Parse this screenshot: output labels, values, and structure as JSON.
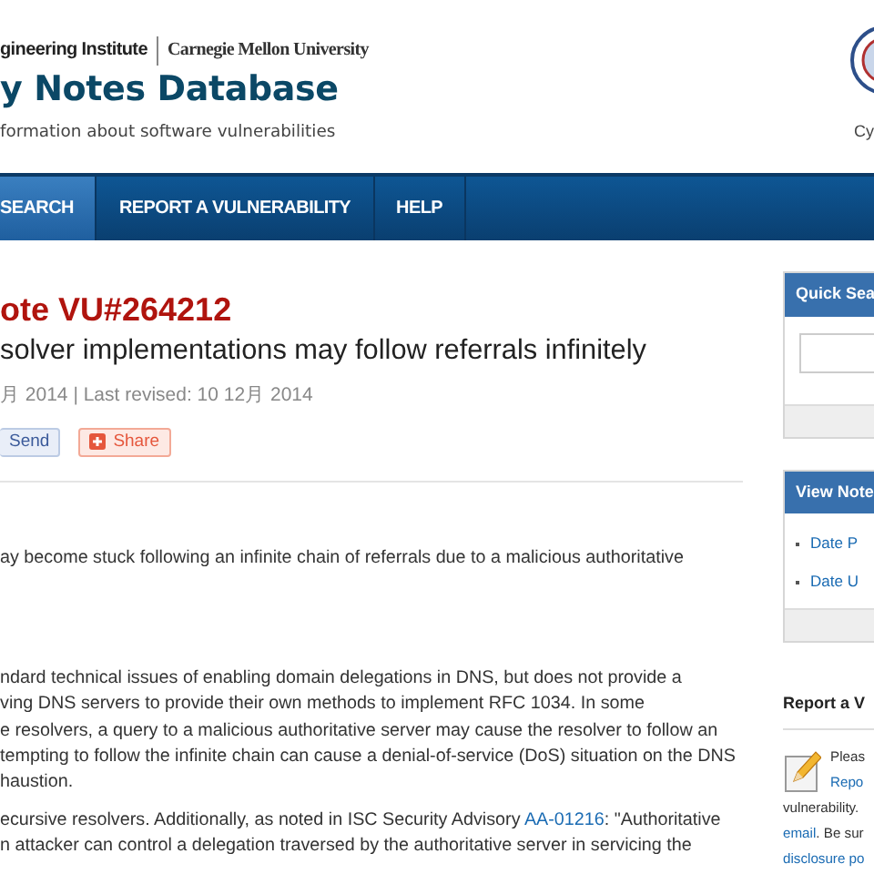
{
  "header": {
    "org_line_1": "gineering Institute",
    "org_line_2": "Carnegie Mellon University",
    "site_title": "y Notes Database",
    "tagline": "formation about software vulnerabilities",
    "partner_caption": "Cy"
  },
  "nav": [
    {
      "label": "SEARCH",
      "selected": true
    },
    {
      "label": "REPORT A VULNERABILITY",
      "selected": false
    },
    {
      "label": "HELP",
      "selected": false
    }
  ],
  "note": {
    "id_title": "ote VU#264212",
    "headline": "solver implementations may follow referrals infinitely",
    "dates": "月 2014 | Last revised: 10 12月 2014",
    "share_buttons": [
      {
        "kind": "send",
        "label": "Send"
      },
      {
        "kind": "share",
        "label": "Share"
      }
    ],
    "paragraphs": [
      {
        "lines": [
          [
            {
              "text": "ay become stuck following an infinite chain of referrals due to a malicious authoritative",
              "link": false
            }
          ]
        ]
      },
      {
        "lines": [
          [
            {
              "text": "ndard technical issues of enabling domain delegations in DNS, but does not provide a",
              "link": false
            }
          ],
          [
            {
              "text": "ving DNS servers to provide their own methods to implement RFC 1034. In some",
              "link": false
            }
          ],
          [
            {
              "text": "e resolvers, a query to a malicious authoritative server may cause the resolver to follow an",
              "link": false
            }
          ],
          [
            {
              "text": "tempting to follow the infinite chain can cause a denial-of-service (DoS) situation on the DNS",
              "link": false
            }
          ],
          [
            {
              "text": "haustion.",
              "link": false
            }
          ]
        ]
      },
      {
        "lines": [
          [
            {
              "text": "ecursive resolvers. Additionally, as noted in ISC Security Advisory ",
              "link": false
            },
            {
              "text": "AA-01216",
              "link": true
            },
            {
              "text": ": \"Authoritative",
              "link": false
            }
          ],
          [
            {
              "text": "n attacker can control a delegation traversed by the authoritative server in servicing the",
              "link": false
            }
          ]
        ]
      }
    ]
  },
  "sidebar": {
    "quick_search": {
      "title": "Quick Sea"
    },
    "view_notes": {
      "title": "View Note",
      "links": [
        "Date P",
        "Date U"
      ]
    },
    "report": {
      "title": "Report a V",
      "lines_beside_icon": [
        [
          {
            "text": "Pleas",
            "link": false
          }
        ],
        [
          {
            "text": "Repo",
            "link": true
          }
        ]
      ],
      "lines": [
        [
          {
            "text": "vulnerability.",
            "link": false
          }
        ],
        [
          {
            "text": "email",
            "link": true
          },
          {
            "text": ". Be sur",
            "link": false
          }
        ],
        [
          {
            "text": "disclosure po",
            "link": true
          }
        ]
      ]
    }
  }
}
